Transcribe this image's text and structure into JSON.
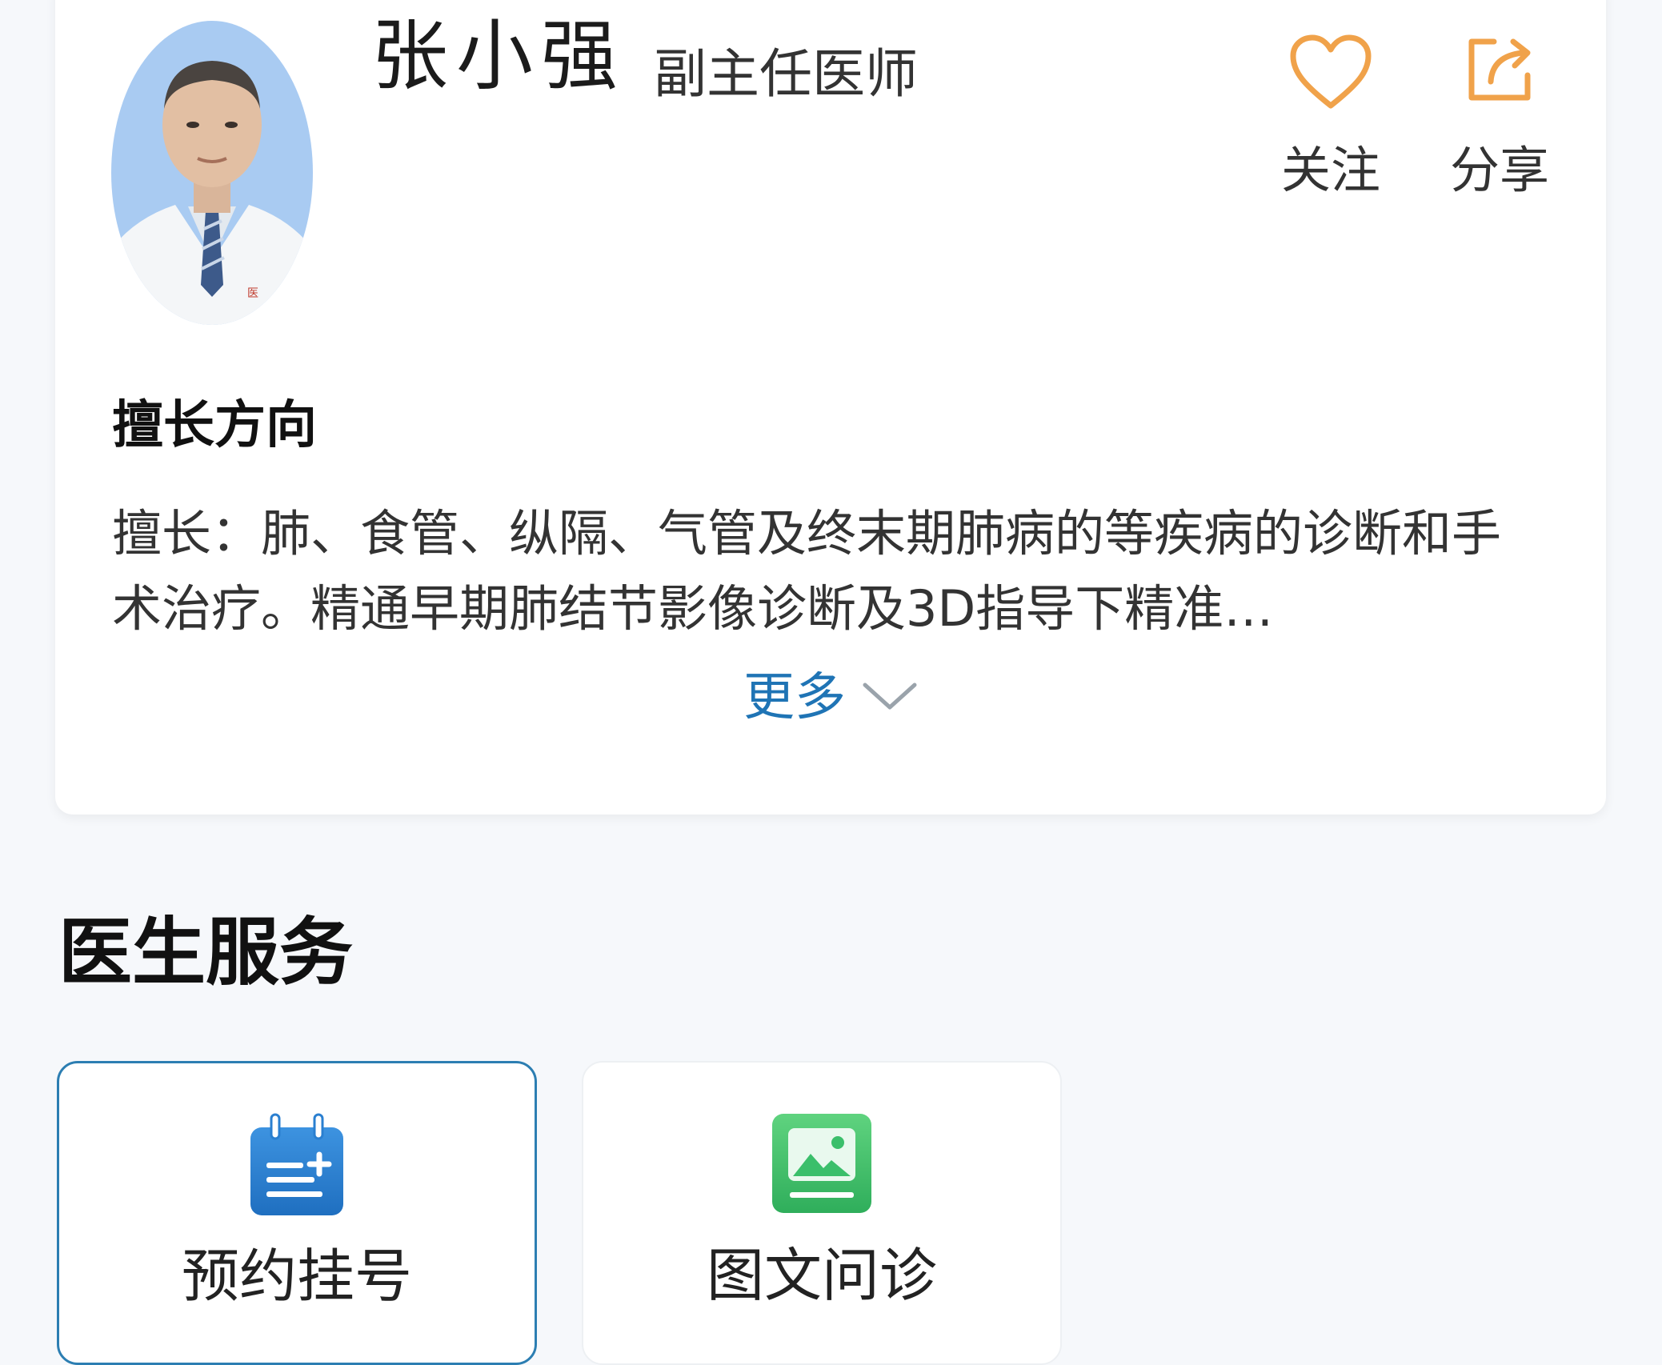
{
  "doctor": {
    "name": "张小强",
    "title": "副主任医师"
  },
  "actions": {
    "follow_label": "关注",
    "share_label": "分享",
    "accent_color": "#f0a24a"
  },
  "specialty": {
    "heading": "擅长方向",
    "text": "擅长：肺、食管、纵隔、气管及终末期肺病的等疾病的诊断和手术治疗。精通早期肺结节影像诊断及3D指导下精准…",
    "more_label": "更多",
    "more_icon": "chevron-down-icon"
  },
  "services": {
    "title": "医生服务",
    "items": [
      {
        "label": "预约挂号",
        "icon": "calendar-add-icon",
        "color": "#2a7fd0"
      },
      {
        "label": "图文问诊",
        "icon": "image-icon",
        "color": "#3bbf6b"
      }
    ]
  }
}
